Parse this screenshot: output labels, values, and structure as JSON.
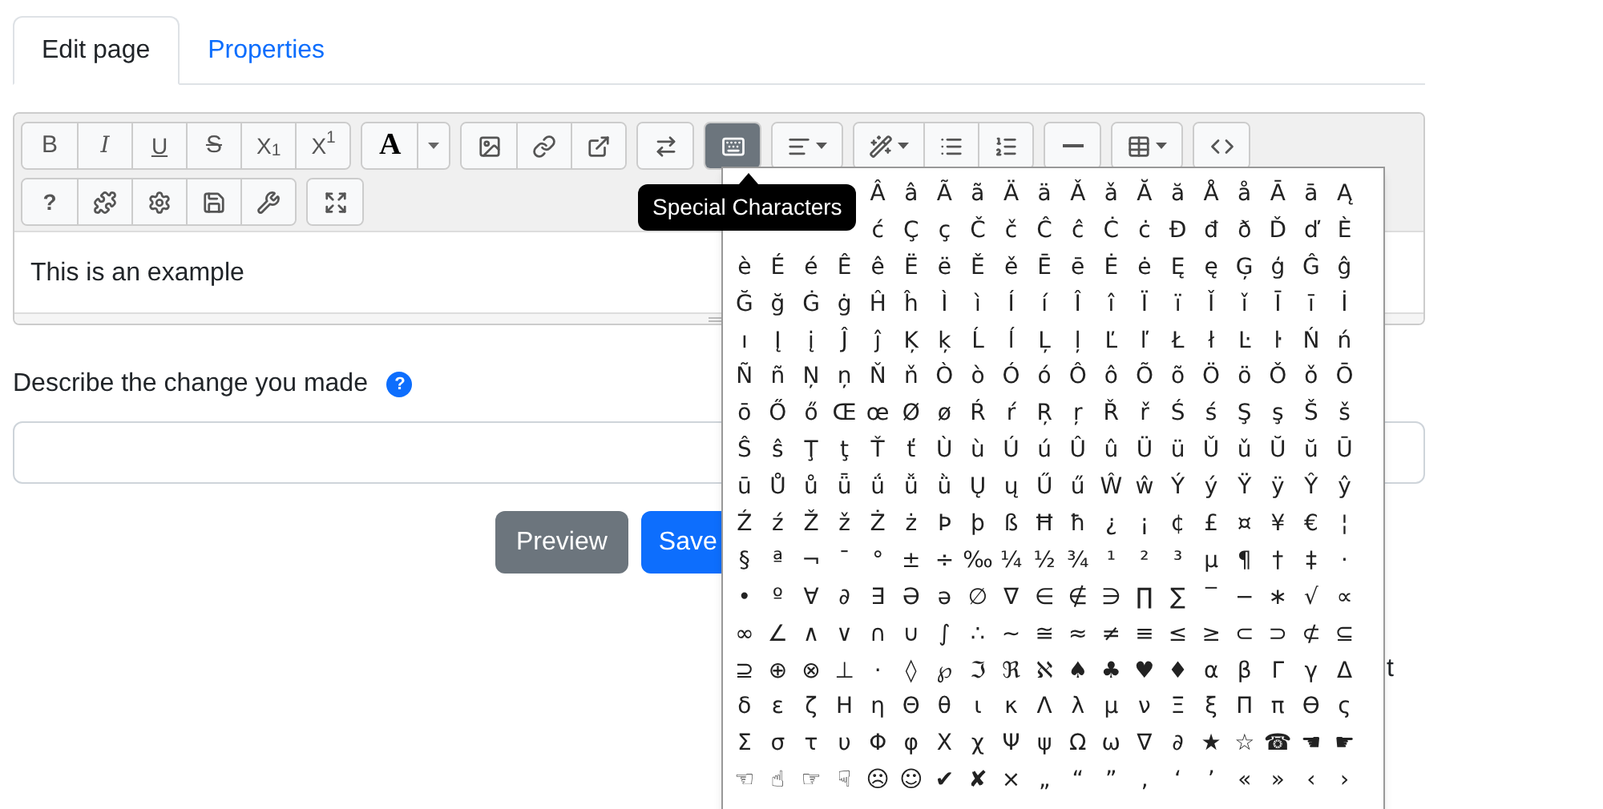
{
  "tabs": [
    {
      "label": "Edit page",
      "selected": true
    },
    {
      "label": "Properties",
      "selected": false
    }
  ],
  "toolbar": {
    "rows": [
      [
        [
          {
            "kind": "text",
            "label": "B"
          },
          {
            "kind": "text",
            "label": "I"
          },
          {
            "kind": "text",
            "label": "U"
          },
          {
            "kind": "text",
            "label": "S"
          },
          {
            "kind": "text",
            "label": "X$_{1}$"
          },
          {
            "kind": "text",
            "label": "X$^{1}$"
          }
        ],
        [
          {
            "kind": "text",
            "label": "A"
          },
          {
            "kind": "caret"
          }
        ],
        [
          {
            "kind": "icon",
            "selected": false
          },
          {
            "kind": "icon",
            "selected": false
          },
          {
            "kind": "icon",
            "selected": false
          }
        ],
        [
          {
            "kind": "icon",
            "selected": false
          }
        ],
        [
          {
            "kind": "icon",
            "selected": true
          }
        ],
        [
          {
            "kind": "icon",
            "selected": false,
            "dropdown": true
          }
        ],
        [
          {
            "kind": "icon",
            "selected": false,
            "dropdown": true
          },
          {
            "kind": "icon",
            "selected": false
          },
          {
            "kind": "icon",
            "selected": false
          }
        ],
        [
          {
            "kind": "icon",
            "selected": false
          }
        ],
        [
          {
            "kind": "icon",
            "selected": false,
            "dropdown": true
          }
        ],
        [
          {
            "kind": "icon",
            "selected": false
          }
        ]
      ],
      [
        [
          {
            "kind": "text",
            "label": "?"
          },
          {
            "kind": "icon",
            "selected": false
          },
          {
            "kind": "icon",
            "selected": false
          },
          {
            "kind": "icon",
            "selected": false
          },
          {
            "kind": "icon",
            "selected": false
          }
        ],
        [
          {
            "kind": "icon",
            "selected": false
          }
        ]
      ]
    ]
  },
  "editor": {
    "content": "This is an example"
  },
  "change_field": {
    "label": "Describe the change you made",
    "help_mark": "?"
  },
  "buttons": [
    {
      "label": "Preview",
      "kind": "secondary"
    },
    {
      "label": "Save",
      "kind": "primary"
    }
  ],
  "stray_text": "t",
  "tooltip": "Special Characters",
  "special_characters": [
    [
      "Â",
      "â",
      "Ã",
      "ã",
      "Ä",
      "ä",
      "Ǎ",
      "ǎ",
      "Ă",
      "ă",
      "Å",
      "å",
      "Ā",
      "ā",
      "Ą"
    ],
    [
      "ć",
      "Ç",
      "ç",
      "Č",
      "č",
      "Ĉ",
      "ĉ",
      "Ċ",
      "ċ",
      "Đ",
      "đ",
      "ð",
      "Ď",
      "ď",
      "È"
    ],
    [
      "è",
      "É",
      "é",
      "Ê",
      "ê",
      "Ë",
      "ë",
      "Ě",
      "ě",
      "Ē",
      "ē",
      "Ė",
      "ė",
      "Ę",
      "ę",
      "Ģ",
      "ģ",
      "Ĝ",
      "ĝ"
    ],
    [
      "Ğ",
      "ğ",
      "Ġ",
      "ġ",
      "Ĥ",
      "ĥ",
      "Ì",
      "ì",
      "Í",
      "í",
      "Î",
      "î",
      "Ï",
      "ï",
      "Ǐ",
      "ǐ",
      "Ī",
      "ī",
      "İ"
    ],
    [
      "ı",
      "Į",
      "į",
      "Ĵ",
      "ĵ",
      "Ķ",
      "ķ",
      "Ĺ",
      "ĺ",
      "Ļ",
      "ļ",
      "Ľ",
      "ľ",
      "Ł",
      "ł",
      "Ŀ",
      "ŀ",
      "Ń",
      "ń"
    ],
    [
      "Ñ",
      "ñ",
      "Ņ",
      "ņ",
      "Ň",
      "ň",
      "Ò",
      "ò",
      "Ó",
      "ó",
      "Ô",
      "ô",
      "Õ",
      "õ",
      "Ö",
      "ö",
      "Ǒ",
      "ǒ",
      "Ō"
    ],
    [
      "ō",
      "Ő",
      "ő",
      "Œ",
      "œ",
      "Ø",
      "ø",
      "Ŕ",
      "ŕ",
      "Ŗ",
      "ŗ",
      "Ř",
      "ř",
      "Ś",
      "ś",
      "Ş",
      "ş",
      "Š",
      "š"
    ],
    [
      "Ŝ",
      "ŝ",
      "Ţ",
      "ţ",
      "Ť",
      "ť",
      "Ù",
      "ù",
      "Ú",
      "ú",
      "Û",
      "û",
      "Ü",
      "ü",
      "Ǔ",
      "ǔ",
      "Ŭ",
      "ŭ",
      "Ū"
    ],
    [
      "ū",
      "Ů",
      "ů",
      "ǖ",
      "ǘ",
      "ǚ",
      "ǜ",
      "Ų",
      "ų",
      "Ű",
      "ű",
      "Ŵ",
      "ŵ",
      "Ý",
      "ý",
      "Ÿ",
      "ÿ",
      "Ŷ",
      "ŷ"
    ],
    [
      "Ź",
      "ź",
      "Ž",
      "ž",
      "Ż",
      "ż",
      "Þ",
      "þ",
      "ß",
      "Ħ",
      "ħ",
      "¿",
      "¡",
      "¢",
      "£",
      "¤",
      "¥",
      "€",
      "¦"
    ],
    [
      "§",
      "ª",
      "¬",
      "¯",
      "°",
      "±",
      "÷",
      "‰",
      "¼",
      "½",
      "¾",
      "¹",
      "²",
      "³",
      "µ",
      "¶",
      "†",
      "‡",
      "·"
    ],
    [
      "•",
      "º",
      "∀",
      "∂",
      "∃",
      "Ə",
      "ə",
      "∅",
      "∇",
      "∈",
      "∉",
      "∋",
      "∏",
      "∑",
      "‾",
      "−",
      "∗",
      "√",
      "∝"
    ],
    [
      "∞",
      "∠",
      "∧",
      "∨",
      "∩",
      "∪",
      "∫",
      "∴",
      "∼",
      "≅",
      "≈",
      "≠",
      "≡",
      "≤",
      "≥",
      "⊂",
      "⊃",
      "⊄",
      "⊆"
    ],
    [
      "⊇",
      "⊕",
      "⊗",
      "⊥",
      "⋅",
      "◊",
      "℘",
      "ℑ",
      "ℜ",
      "ℵ",
      "♠",
      "♣",
      "♥",
      "♦",
      "α",
      "β",
      "Γ",
      "γ",
      "Δ"
    ],
    [
      "δ",
      "ε",
      "ζ",
      "Η",
      "η",
      "Θ",
      "θ",
      "ι",
      "κ",
      "Λ",
      "λ",
      "μ",
      "ν",
      "Ξ",
      "ξ",
      "Π",
      "π",
      "ϴ",
      "ς"
    ],
    [
      "Σ",
      "σ",
      "τ",
      "υ",
      "Φ",
      "φ",
      "Χ",
      "χ",
      "Ψ",
      "ψ",
      "Ω",
      "ω",
      "∇",
      "∂",
      "★",
      "☆",
      "☎",
      "☚",
      "☛"
    ],
    [
      "☜",
      "☝",
      "☞",
      "☟",
      "☹",
      "☺",
      "✔",
      "✘",
      "×",
      "„",
      "“",
      "”",
      "‚",
      "‘",
      "’",
      "«",
      "»",
      "‹",
      "›"
    ]
  ]
}
